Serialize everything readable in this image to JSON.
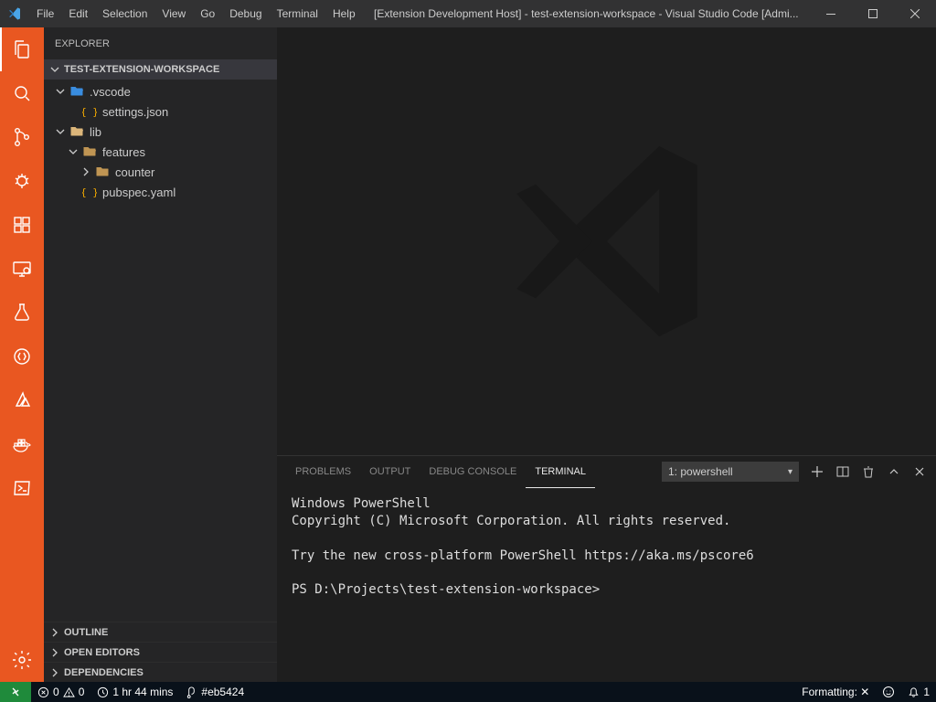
{
  "titlebar": {
    "title": "[Extension Development Host] - test-extension-workspace - Visual Studio Code [Admi...",
    "menu": [
      "File",
      "Edit",
      "Selection",
      "View",
      "Go",
      "Debug",
      "Terminal",
      "Help"
    ]
  },
  "activitybar": {
    "items": [
      {
        "name": "explorer",
        "active": true
      },
      {
        "name": "search",
        "active": false
      },
      {
        "name": "source-control",
        "active": false
      },
      {
        "name": "run-debug",
        "active": false
      },
      {
        "name": "extensions",
        "active": false
      },
      {
        "name": "remote-explorer",
        "active": false
      },
      {
        "name": "test",
        "active": false
      },
      {
        "name": "sql",
        "active": false
      },
      {
        "name": "azure",
        "active": false
      },
      {
        "name": "docker",
        "active": false
      },
      {
        "name": "powershell",
        "active": false
      }
    ],
    "bottom": [
      {
        "name": "settings"
      }
    ]
  },
  "sidebar": {
    "title": "EXPLORER",
    "workspace": "TEST-EXTENSION-WORKSPACE",
    "tree": [
      {
        "depth": 0,
        "type": "folder-open",
        "label": ".vscode",
        "twist": "down",
        "iconColor": "#3a8de0"
      },
      {
        "depth": 1,
        "type": "file",
        "label": "settings.json",
        "iconColor": "#f2a900",
        "iconName": "json-icon"
      },
      {
        "depth": 0,
        "type": "folder-open",
        "label": "lib",
        "twist": "down",
        "iconColor": "#dcb67a"
      },
      {
        "depth": 1,
        "type": "folder-open",
        "label": "features",
        "twist": "down",
        "iconColor": "#c09553"
      },
      {
        "depth": 2,
        "type": "folder",
        "label": "counter",
        "twist": "right",
        "iconColor": "#c09553"
      },
      {
        "depth": 1,
        "type": "file",
        "label": "pubspec.yaml",
        "iconColor": "#f2a900",
        "iconName": "yaml-icon"
      }
    ],
    "bottomSections": [
      "OUTLINE",
      "OPEN EDITORS",
      "DEPENDENCIES"
    ]
  },
  "panel": {
    "tabs": [
      {
        "label": "PROBLEMS",
        "active": false
      },
      {
        "label": "OUTPUT",
        "active": false
      },
      {
        "label": "DEBUG CONSOLE",
        "active": false
      },
      {
        "label": "TERMINAL",
        "active": true
      }
    ],
    "terminalSelect": "1: powershell",
    "terminal": {
      "lines": [
        "Windows PowerShell",
        "Copyright (C) Microsoft Corporation. All rights reserved.",
        "",
        "Try the new cross-platform PowerShell https://aka.ms/pscore6",
        "",
        "PS D:\\Projects\\test-extension-workspace>"
      ]
    }
  },
  "statusbar": {
    "errors": "0",
    "warnings": "0",
    "time": "1 hr 44 mins",
    "branch": "#eb5424",
    "formatting": "Formatting: ✕",
    "bell": "1"
  }
}
